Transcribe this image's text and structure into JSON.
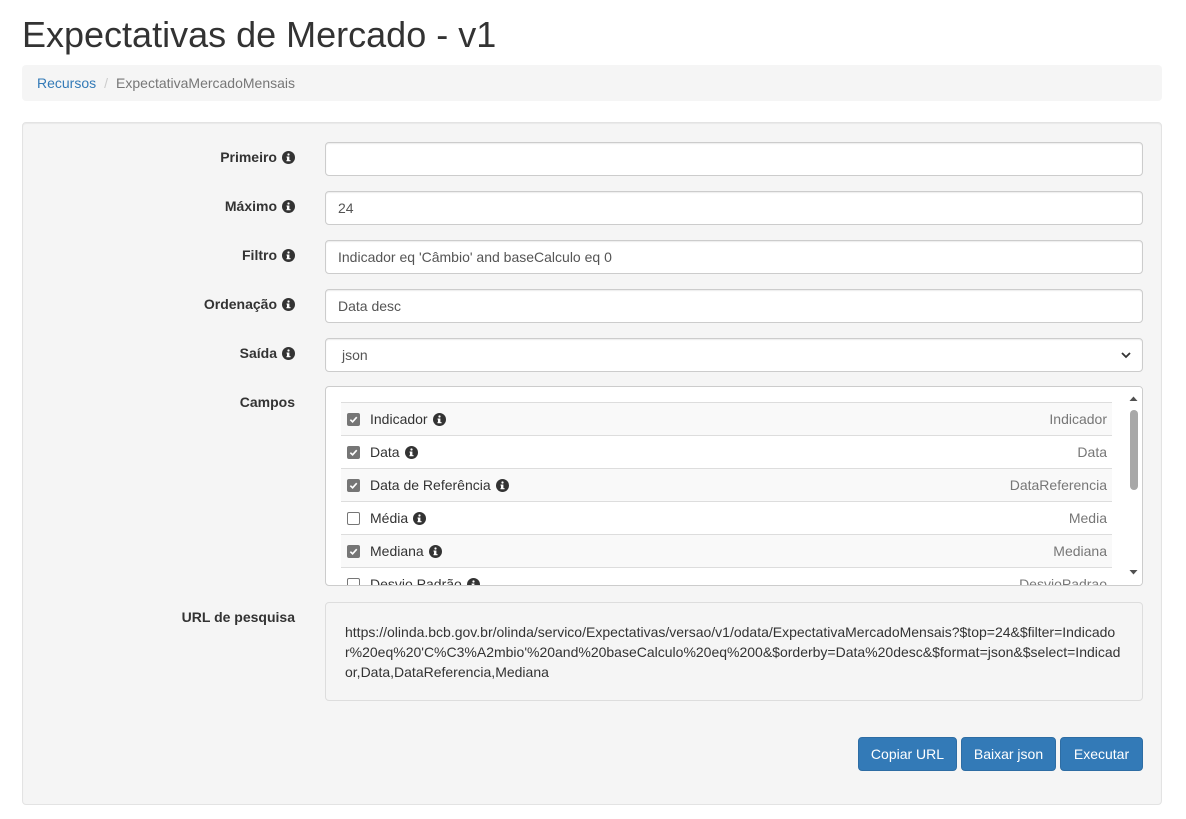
{
  "page": {
    "title": "Expectativas de Mercado - v1"
  },
  "breadcrumb": {
    "link": "Recursos",
    "separator": "/",
    "current": "ExpectativaMercadoMensais"
  },
  "form": {
    "primeiro": {
      "label": "Primeiro",
      "value": ""
    },
    "maximo": {
      "label": "Máximo",
      "value": "24"
    },
    "filtro": {
      "label": "Filtro",
      "value": "Indicador eq 'Câmbio' and baseCalculo eq 0"
    },
    "ordenacao": {
      "label": "Ordenação",
      "value": "Data desc"
    },
    "saida": {
      "label": "Saída",
      "value": "json"
    },
    "campos": {
      "label": "Campos",
      "items": [
        {
          "label": "Indicador",
          "key": "Indicador",
          "checked": true
        },
        {
          "label": "Data",
          "key": "Data",
          "checked": true
        },
        {
          "label": "Data de Referência",
          "key": "DataReferencia",
          "checked": true
        },
        {
          "label": "Média",
          "key": "Media",
          "checked": false
        },
        {
          "label": "Mediana",
          "key": "Mediana",
          "checked": true
        },
        {
          "label": "Desvio Padrão",
          "key": "DesvioPadrao",
          "checked": false
        }
      ]
    },
    "url": {
      "label": "URL de pesquisa",
      "value": "https://olinda.bcb.gov.br/olinda/servico/Expectativas/versao/v1/odata/ExpectativaMercadoMensais?$top=24&$filter=Indicador%20eq%20'C%C3%A2mbio'%20and%20baseCalculo%20eq%200&$orderby=Data%20desc&$format=json&$select=Indicador,Data,DataReferencia,Mediana"
    }
  },
  "buttons": {
    "copy": "Copiar URL",
    "download": "Baixar json",
    "run": "Executar"
  },
  "icons": {
    "info": "info-circle-icon",
    "select": "chevron-down-icon",
    "checkbox": "check-icon"
  },
  "colors": {
    "primary": "#337ab7",
    "link": "#337ab7",
    "panel": "#f5f5f5"
  }
}
